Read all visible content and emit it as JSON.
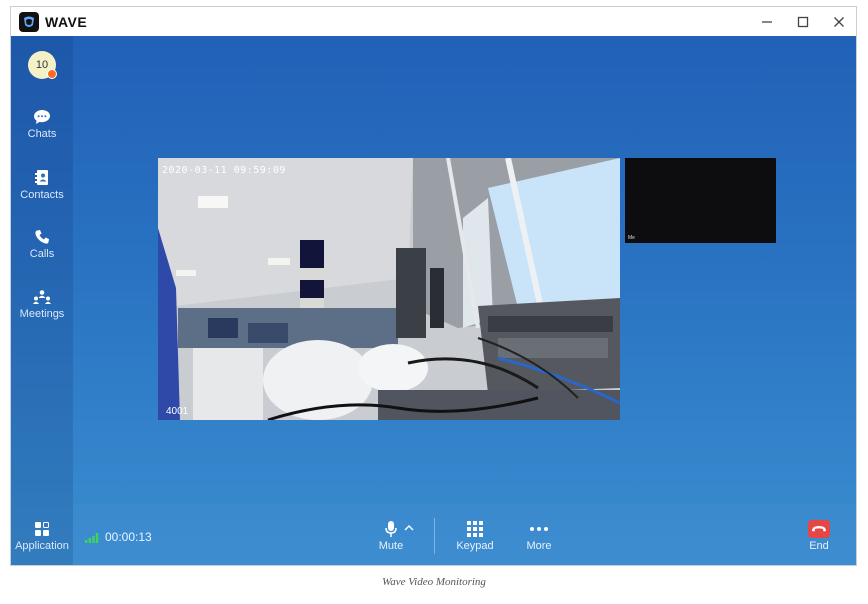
{
  "window": {
    "app_title": "WAVE",
    "controls": [
      "minimize",
      "maximize",
      "close"
    ]
  },
  "sidebar": {
    "avatar_text": "10",
    "items": [
      {
        "label": "Chats",
        "icon": "chat-icon"
      },
      {
        "label": "Contacts",
        "icon": "contacts-icon"
      },
      {
        "label": "Calls",
        "icon": "phone-icon"
      },
      {
        "label": "Meetings",
        "icon": "meetings-icon"
      }
    ],
    "bottom_item": {
      "label": "Application",
      "icon": "apps-icon"
    }
  },
  "video": {
    "timestamp": "2020-03-11 09:59:09",
    "participant_id": "4001",
    "pip_label": "Me"
  },
  "call_bar": {
    "duration": "00:00:13",
    "mute_label": "Mute",
    "keypad_label": "Keypad",
    "more_label": "More",
    "end_label": "End"
  },
  "caption": "Wave Video Monitoring",
  "colors": {
    "accent": "#2a6fc0",
    "end_call": "#e84545",
    "status_dot": "#ff6b1e",
    "signal": "#3ad65a"
  }
}
